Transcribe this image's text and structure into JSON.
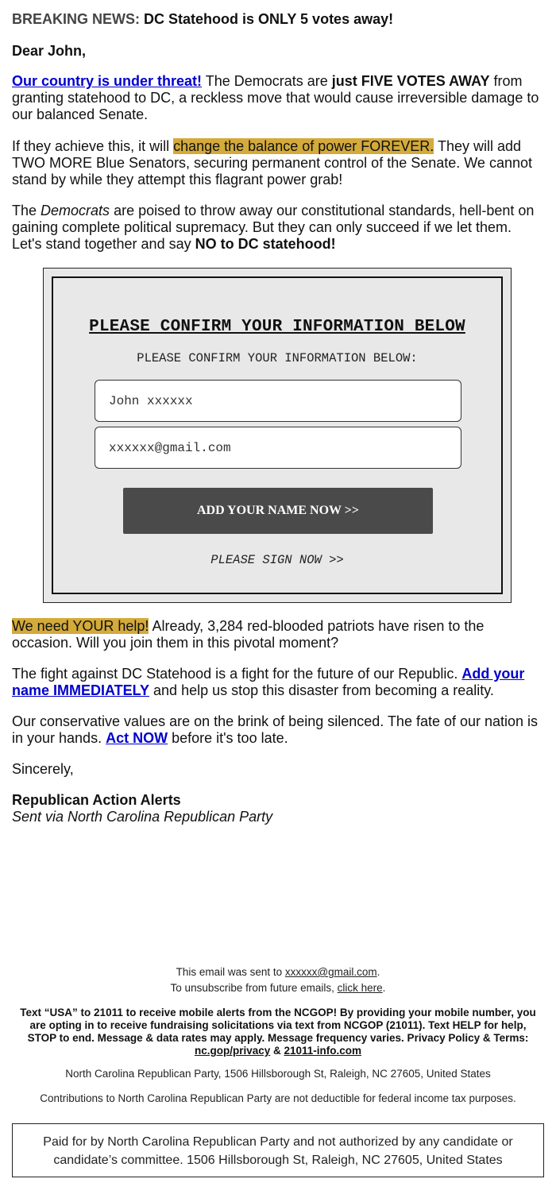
{
  "headline": {
    "label": "BREAKING NEWS:",
    "text": "DC Statehood is ONLY 5 votes away!"
  },
  "greeting": "Dear John,",
  "paragraph1": {
    "link": "Our country is under threat!",
    "text_a": " The Democrats are ",
    "bold": "just FIVE VOTES AWAY",
    "text_b": " from granting statehood to DC, a reckless move that would cause irreversible damage to our balanced Senate."
  },
  "paragraph2": {
    "text_a": "If they achieve this, it will ",
    "highlight": "change the balance of power FOREVER.",
    "text_b": " They will add TWO MORE Blue Senators, securing permanent control of the Senate. We cannot stand by while they attempt this flagrant power grab!"
  },
  "paragraph3": {
    "text_a": "The ",
    "italic": "Democrats",
    "text_b": " are poised to throw away our constitutional standards, hell-bent on gaining complete political supremacy. But they can only succeed if we let them. Let's stand together and say ",
    "bold": "NO to DC statehood!"
  },
  "form": {
    "title": "PLEASE CONFIRM YOUR INFORMATION BELOW",
    "subtitle": "PLEASE CONFIRM YOUR INFORMATION BELOW:",
    "name_value": "John xxxxxx",
    "email_value": "xxxxxx@gmail.com",
    "submit_label": "ADD YOUR NAME NOW >>",
    "sign_now_label": "PLEASE SIGN NOW >>"
  },
  "paragraph4": {
    "highlight": "We need YOUR help!",
    "text": " Already, 3,284 red-blooded patriots have risen to the occasion. Will you join them in this pivotal moment?"
  },
  "paragraph5": {
    "text_a": "The fight against DC Statehood is a fight for the future of our Republic. ",
    "link": "Add your name IMMEDIATELY",
    "text_b": " and help us stop this disaster from becoming a reality."
  },
  "paragraph6": {
    "text_a": "Our conservative values are on the brink of being silenced. The fate of our nation is in your hands. ",
    "link": "Act NOW",
    "text_b": " before it's too late."
  },
  "closing": "Sincerely,",
  "signature": {
    "name": "Republican Action Alerts",
    "via": "Sent via North Carolina Republican Party"
  },
  "footer": {
    "sent_prefix": "This email was sent to ",
    "sent_email": "xxxxxx@gmail.com",
    "sent_suffix": ".",
    "unsub_prefix": "To unsubscribe from future emails, ",
    "unsub_link": "click here",
    "unsub_suffix": ".",
    "sms_text": "Text “USA” to 21011 to receive mobile alerts from the NCGOP! By providing your mobile number, you are opting in to receive fundraising solicitations via text from NCGOP (21011). Text HELP for help, STOP to end. Message & data rates may apply. Message frequency varies. Privacy Policy & Terms: ",
    "privacy_link": "nc.gop/privacy",
    "amp": " & ",
    "info_link": "21011-info.com",
    "address": "North Carolina Republican Party, 1506 Hillsborough St, Raleigh, NC 27605, United States",
    "tax_notice": "Contributions to North Carolina Republican Party are not deductible for federal income tax purposes.",
    "paid_for": "Paid for by North Carolina Republican Party and not authorized by any candidate or candidate’s committee. 1506 Hillsborough St, Raleigh, NC 27605, United States"
  },
  "colors": {
    "highlight": "#d4aa3a",
    "link": "#0000cc",
    "button": "#4a4a4a",
    "form_bg": "#e8e8e8"
  }
}
